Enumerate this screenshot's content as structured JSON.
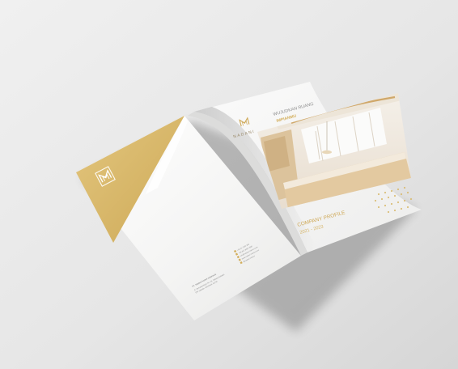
{
  "colors": {
    "backdrop_light": "#ececec",
    "backdrop_dark": "#d9d9d9",
    "paper": "#f7f7f6",
    "paper_shade": "#e6e6e5",
    "gold": "#dcbb6c",
    "gold_dark": "#c9a653",
    "photo_wall": "#efe8de",
    "photo_wood": "#d8b98c"
  },
  "icons": {
    "front_logo": "mm-monogram-logo-icon",
    "back_logo": "mm-monogram-logo-icon",
    "contact_bullets": "gold-square-bullet-icon"
  },
  "front_cover": {
    "brand": "NADANI",
    "headline_line1": "WUJUDKAN RUANG",
    "headline_line2": "IMPIANMU",
    "profile_title": "COMPANY PROFILE",
    "profile_years": "2021 - 2023"
  },
  "back_cover": {
    "company_name": "PT. Nadani Arsitek Indonesia",
    "address_line1": "Jl. Kemang Raya No. 18, Jakarta Selatan",
    "address_line2": "DKI Jakarta, Indonesia 12730",
    "contacts": [
      "+62 21 7192 345",
      "+62 812 3456 7890",
      "info@nadani-interior.com",
      "www.nadani-interior.com",
      "@nadani.interior"
    ]
  }
}
